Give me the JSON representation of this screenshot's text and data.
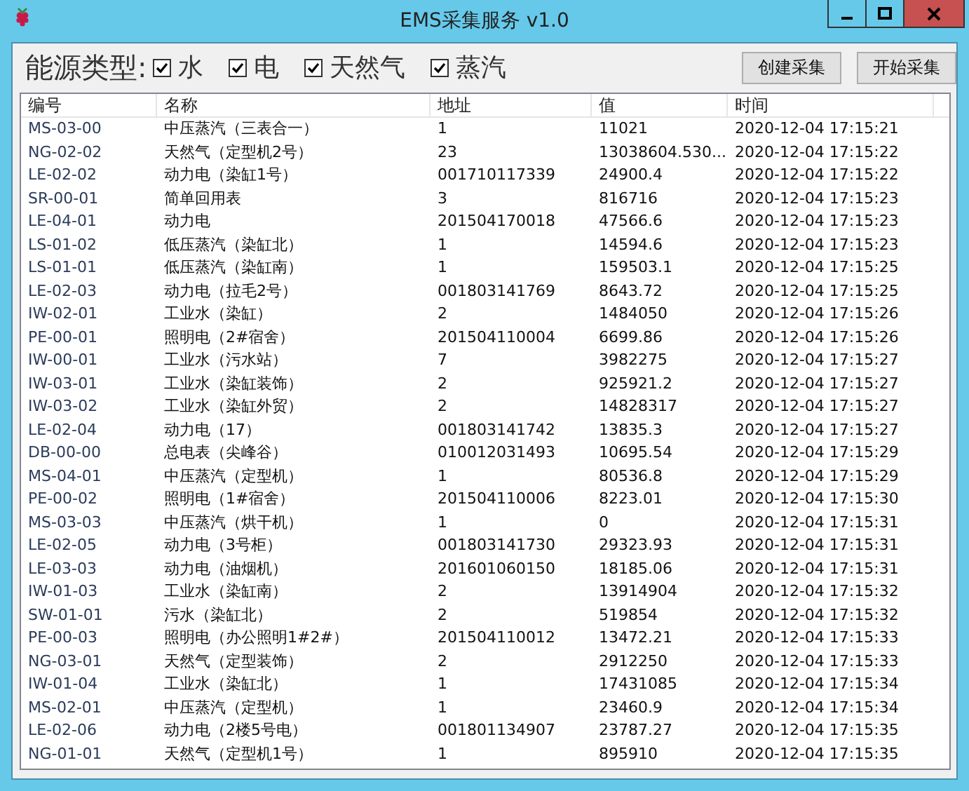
{
  "window": {
    "title": "EMS采集服务 v1.0"
  },
  "energy_types": {
    "label": "能源类型:",
    "options": [
      {
        "label": "水",
        "checked": true
      },
      {
        "label": "电",
        "checked": true
      },
      {
        "label": "天然气",
        "checked": true
      },
      {
        "label": "蒸汽",
        "checked": true
      }
    ]
  },
  "buttons": [
    "创建采集",
    "开始采集"
  ],
  "table": {
    "columns": [
      "编号",
      "名称",
      "地址",
      "值",
      "时间"
    ],
    "rows": [
      [
        "MS-03-00",
        "中压蒸汽（三表合一）",
        "1",
        "11021",
        "2020-12-04 17:15:21"
      ],
      [
        "NG-02-02",
        "天然气（定型机2号）",
        "23",
        "13038604.530...",
        "2020-12-04 17:15:22"
      ],
      [
        "LE-02-02",
        "动力电（染缸1号）",
        "001710117339",
        "24900.4",
        "2020-12-04 17:15:22"
      ],
      [
        "SR-00-01",
        "简单回用表",
        "3",
        "816716",
        "2020-12-04 17:15:23"
      ],
      [
        "LE-04-01",
        "动力电",
        "201504170018",
        "47566.6",
        "2020-12-04 17:15:23"
      ],
      [
        "LS-01-02",
        "低压蒸汽（染缸北）",
        "1",
        "14594.6",
        "2020-12-04 17:15:23"
      ],
      [
        "LS-01-01",
        "低压蒸汽（染缸南）",
        "1",
        "159503.1",
        "2020-12-04 17:15:25"
      ],
      [
        "LE-02-03",
        "动力电（拉毛2号）",
        "001803141769",
        "8643.72",
        "2020-12-04 17:15:25"
      ],
      [
        "IW-02-01",
        "工业水（染缸）",
        "2",
        "1484050",
        "2020-12-04 17:15:26"
      ],
      [
        "PE-00-01",
        "照明电（2#宿舍）",
        "201504110004",
        "6699.86",
        "2020-12-04 17:15:26"
      ],
      [
        "IW-00-01",
        "工业水（污水站）",
        "7",
        "3982275",
        "2020-12-04 17:15:27"
      ],
      [
        "IW-03-01",
        "工业水（染缸装饰）",
        "2",
        "925921.2",
        "2020-12-04 17:15:27"
      ],
      [
        "IW-03-02",
        "工业水（染缸外贸）",
        "2",
        "14828317",
        "2020-12-04 17:15:27"
      ],
      [
        "LE-02-04",
        "动力电（17）",
        "001803141742",
        "13835.3",
        "2020-12-04 17:15:27"
      ],
      [
        "DB-00-00",
        "总电表（尖峰谷）",
        "010012031493",
        "10695.54",
        "2020-12-04 17:15:29"
      ],
      [
        "MS-04-01",
        "中压蒸汽（定型机）",
        "1",
        "80536.8",
        "2020-12-04 17:15:29"
      ],
      [
        "PE-00-02",
        "照明电（1#宿舍）",
        "201504110006",
        "8223.01",
        "2020-12-04 17:15:30"
      ],
      [
        "MS-03-03",
        "中压蒸汽（烘干机）",
        "1",
        "0",
        "2020-12-04 17:15:31"
      ],
      [
        "LE-02-05",
        "动力电（3号柜）",
        "001803141730",
        "29323.93",
        "2020-12-04 17:15:31"
      ],
      [
        "LE-03-03",
        "动力电（油烟机）",
        "201601060150",
        "18185.06",
        "2020-12-04 17:15:31"
      ],
      [
        "IW-01-03",
        "工业水（染缸南）",
        "2",
        "13914904",
        "2020-12-04 17:15:32"
      ],
      [
        "SW-01-01",
        "污水（染缸北）",
        "2",
        "519854",
        "2020-12-04 17:15:32"
      ],
      [
        "PE-00-03",
        "照明电（办公照明1#2#）",
        "201504110012",
        "13472.21",
        "2020-12-04 17:15:33"
      ],
      [
        "NG-03-01",
        "天然气（定型装饰）",
        "2",
        "2912250",
        "2020-12-04 17:15:33"
      ],
      [
        "IW-01-04",
        "工业水（染缸北）",
        "1",
        "17431085",
        "2020-12-04 17:15:34"
      ],
      [
        "MS-02-01",
        "中压蒸汽（定型机）",
        "1",
        "23460.9",
        "2020-12-04 17:15:34"
      ],
      [
        "LE-02-06",
        "动力电（2楼5号电）",
        "001801134907",
        "23787.27",
        "2020-12-04 17:15:35"
      ],
      [
        "NG-01-01",
        "天然气（定型机1号）",
        "1",
        "895910",
        "2020-12-04 17:15:35"
      ]
    ]
  }
}
